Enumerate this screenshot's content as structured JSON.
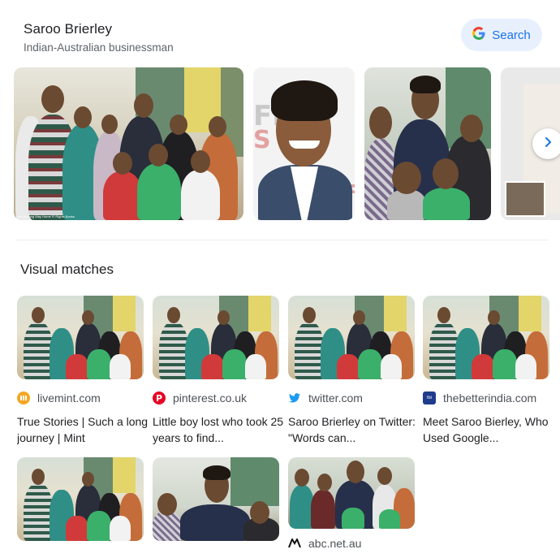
{
  "knowledge_panel": {
    "title": "Saroo Brierley",
    "subtitle": "Indian-Australian businessman",
    "search_label": "Search"
  },
  "images": {
    "caption_small": "Lion: A Long Way Home Fl Rights Books"
  },
  "visual_matches": {
    "heading": "Visual matches",
    "cards": [
      {
        "source": "livemint.com",
        "caption": "True Stories | Such a long journey | Mint",
        "favicon": "livemint-icon"
      },
      {
        "source": "pinterest.co.uk",
        "caption": "Little boy lost who took 25 years to find...",
        "favicon": "pinterest-icon"
      },
      {
        "source": "twitter.com",
        "caption": "Saroo Brierley on Twitter: \"Words can...",
        "favicon": "twitter-icon"
      },
      {
        "source": "thebetterindia.com",
        "caption": "Meet Saroo Bierley, Who Used Google...",
        "favicon": "thebetterindia-icon"
      },
      {
        "source": "",
        "caption": "",
        "favicon": ""
      },
      {
        "source": "",
        "caption": "",
        "favicon": ""
      },
      {
        "source": "abc.net.au",
        "caption": "",
        "favicon": "abc-icon"
      }
    ]
  },
  "colors": {
    "accent": "#1a73e8",
    "pinterest": "#e60023",
    "twitter": "#1d9bf0",
    "livemint": "#f5a623"
  }
}
